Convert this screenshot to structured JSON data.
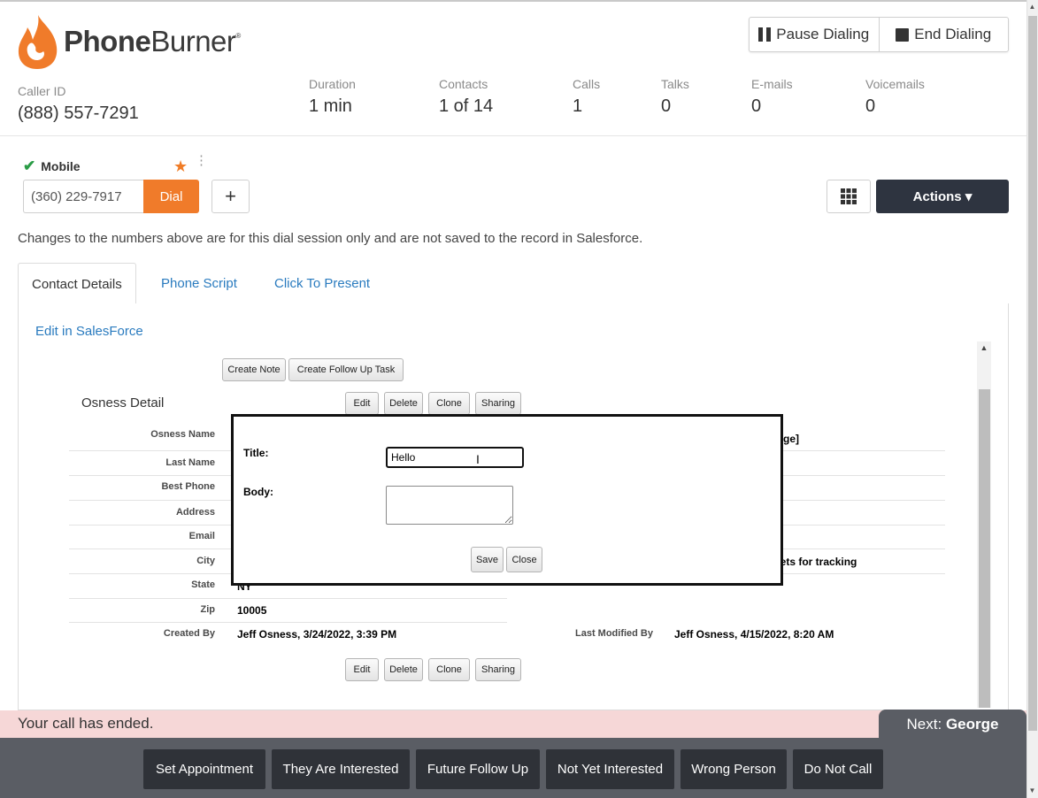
{
  "header": {
    "brand_bold": "Phone",
    "brand_light": "Burner",
    "brand_mark": "®",
    "pause_label": "Pause Dialing",
    "end_label": "End Dialing",
    "caller_id_label": "Caller ID",
    "caller_id_value": "(888) 557-7291",
    "stats": [
      {
        "label": "Duration",
        "value": "1 min"
      },
      {
        "label": "Contacts",
        "value": "1 of 14"
      },
      {
        "label": "Calls",
        "value": "1"
      },
      {
        "label": "Talks",
        "value": "0"
      },
      {
        "label": "E-mails",
        "value": "0"
      },
      {
        "label": "Voicemails",
        "value": "0"
      }
    ]
  },
  "phone": {
    "type_label": "Mobile",
    "number_value": "(360) 229-7917",
    "dial_label": "Dial",
    "add_label": "+",
    "actions_label": "Actions ▾"
  },
  "notice": "Changes to the numbers above are for this dial session only and are not saved to the record in Salesforce.",
  "tabs": [
    {
      "label": "Contact Details"
    },
    {
      "label": "Phone Script"
    },
    {
      "label": "Click To Present"
    }
  ],
  "edit_link": "Edit in SalesForce",
  "salesforce": {
    "create_note": "Create Note",
    "create_task": "Create Follow Up Task",
    "detail_title": "Osness Detail",
    "edit": "Edit",
    "delete": "Delete",
    "clone": "Clone",
    "sharing": "Sharing",
    "fields": [
      {
        "label": "Osness Name"
      },
      {
        "label": "Last Name"
      },
      {
        "label": "Best Phone"
      },
      {
        "label": "Address"
      },
      {
        "label": "Email"
      },
      {
        "label": "City"
      },
      {
        "label": "State",
        "value": "NY"
      },
      {
        "label": "Zip",
        "value": "10005"
      },
      {
        "label": "Created By",
        "value": "Jeff Osness, 3/24/2022, 3:39 PM"
      }
    ],
    "right_partial_1": "ange]",
    "right_partial_2": "eets for tracking",
    "last_modified_label": "Last Modified By",
    "last_modified_value": "Jeff Osness, 4/15/2022, 8:20 AM"
  },
  "note_modal": {
    "title_label": "Title:",
    "title_value": "Hello",
    "body_label": "Body:",
    "save": "Save",
    "close": "Close"
  },
  "call_status": "Your call has ended.",
  "next": {
    "label": "Next:",
    "name": "George"
  },
  "dispositions": [
    "Set Appointment",
    "They Are Interested",
    "Future Follow Up",
    "Not Yet Interested",
    "Wrong Person",
    "Do Not Call"
  ],
  "colors": {
    "accent": "#f07b2a",
    "link": "#2a7bbf",
    "dark_button": "#2e3440",
    "status_bg": "#f6d7d7"
  },
  "icons": [
    "flame-logo-icon",
    "pause-icon",
    "stop-icon",
    "check-icon",
    "star-icon",
    "kebab-icon",
    "grid-icon",
    "caret-down-icon",
    "text-cursor-icon"
  ]
}
